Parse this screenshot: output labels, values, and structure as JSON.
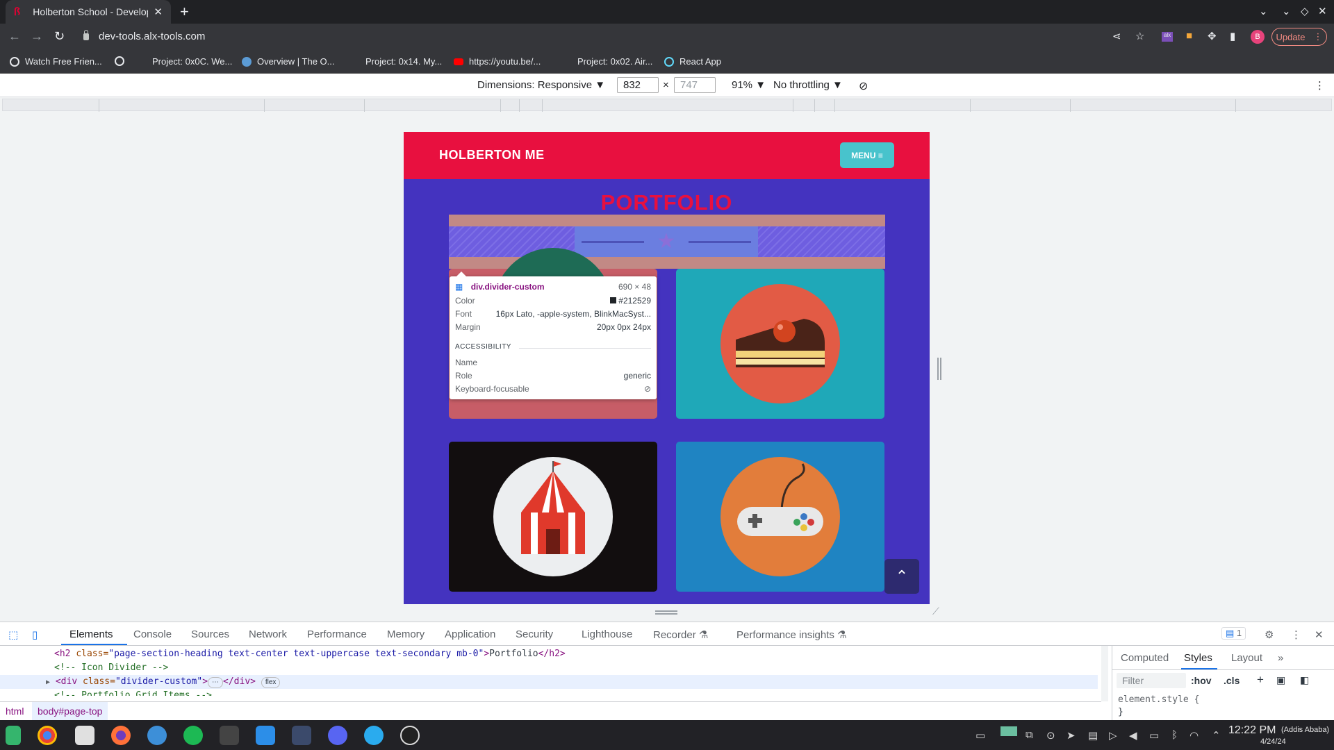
{
  "browser": {
    "tab_title": "Holberton School - Developer",
    "new_tab": "+",
    "url": "dev-tools.alx-tools.com",
    "avatar_letter": "B",
    "update_label": "Update"
  },
  "bookmarks": [
    {
      "label": "Watch Free Frien...",
      "color": "#ffffff"
    },
    {
      "label": "",
      "color": "#ffffff"
    },
    {
      "label": "Project: 0x0C. We...",
      "color": "#35363a"
    },
    {
      "label": "Overview | The O...",
      "color": "#5b9bd5"
    },
    {
      "label": "Project: 0x14. My...",
      "color": "#35363a"
    },
    {
      "label": "https://youtu.be/...",
      "color": "#ff0000"
    },
    {
      "label": "Project: 0x02. Air...",
      "color": "#35363a"
    },
    {
      "label": "React App",
      "color": "#61dafb"
    }
  ],
  "device_toolbar": {
    "dimensions_label": "Dimensions: Responsive ▼",
    "width": "832",
    "times": "×",
    "height": "747",
    "zoom": "91% ▼",
    "throttling": "No throttling ▼"
  },
  "site": {
    "brand": "HOLBERTON ME",
    "menu_label": "MENU ≡",
    "heading": "PORTFOLIO",
    "scroll_top": "⌃"
  },
  "tooltip": {
    "selector": "div.divider-custom",
    "size": "690 × 48",
    "color_label": "Color",
    "color_value": "#212529",
    "font_label": "Font",
    "font_value": "16px Lato, -apple-system, BlinkMacSyst...",
    "margin_label": "Margin",
    "margin_value": "20px 0px 24px",
    "accessibility_heading": "ACCESSIBILITY",
    "name_label": "Name",
    "role_label": "Role",
    "role_value": "generic",
    "focusable_label": "Keyboard-focusable"
  },
  "devtools": {
    "tabs": [
      "Elements",
      "Console",
      "Sources",
      "Network",
      "Performance",
      "Memory",
      "Application",
      "Security",
      "Lighthouse",
      "Recorder ⚗",
      "Performance insights ⚗"
    ],
    "issues_count": "1",
    "code": {
      "line1_tag_open": "<h2 ",
      "line1_attr": "class=",
      "line1_val": "\"page-section-heading text-center text-uppercase text-secondary mb-0\"",
      "line1_text": "Portfolio",
      "line1_tag_close": "</h2>",
      "line1_gt": ">",
      "line2": "<!-- Icon Divider -->",
      "line3_tag_open": "<div ",
      "line3_attr": "class=",
      "line3_val": "\"divider-custom\"",
      "line3_gt": ">",
      "line3_dots": "⋯",
      "line3_close": "</div>",
      "line3_pill": "flex",
      "line4": "<!-- Portfolio Grid Items -->"
    },
    "crumbs": [
      "html",
      "body#page-top"
    ],
    "side_tabs": [
      "Computed",
      "Styles",
      "Layout",
      "»"
    ],
    "filter_placeholder": "Filter",
    "hov": ":hov",
    "cls": ".cls",
    "element_style": "element.style {",
    "element_style_close": "}"
  },
  "taskbar": {
    "time": "12:22 PM",
    "timezone": "(Addis Ababa)",
    "date": "4/24/24"
  }
}
